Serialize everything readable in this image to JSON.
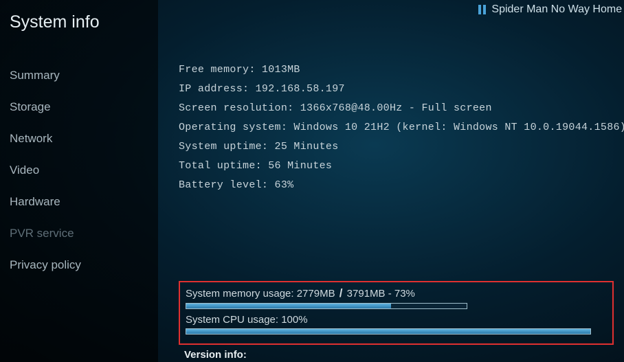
{
  "header": {
    "title": "System info",
    "now_playing": "Spider Man No Way Home"
  },
  "sidebar": {
    "items": [
      {
        "label": "Summary",
        "dim": false
      },
      {
        "label": "Storage",
        "dim": false
      },
      {
        "label": "Network",
        "dim": false
      },
      {
        "label": "Video",
        "dim": false
      },
      {
        "label": "Hardware",
        "dim": false
      },
      {
        "label": "PVR service",
        "dim": true
      },
      {
        "label": "Privacy policy",
        "dim": false
      }
    ]
  },
  "info": {
    "free_memory": "Free memory: 1013MB",
    "ip_address": "IP address: 192.168.58.197",
    "screen_resolution": "Screen resolution: 1366x768@48.00Hz - Full screen",
    "operating_system": "Operating system: Windows 10 21H2 (kernel: Windows NT 10.0.19044.1586)",
    "system_uptime": "System uptime: 25 Minutes",
    "total_uptime": "Total uptime: 56 Minutes",
    "battery_level": "Battery level: 63%"
  },
  "usage": {
    "mem_label_prefix": "System memory usage: 2779MB ",
    "mem_label_suffix": " 3791MB - 73%",
    "slash": "/",
    "mem_percent": 73,
    "cpu_label": "System CPU usage: 100%",
    "cpu_percent": 100
  },
  "version": {
    "label": "Version info:"
  }
}
